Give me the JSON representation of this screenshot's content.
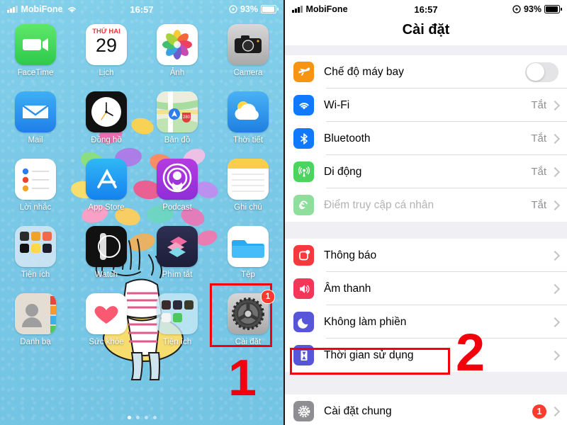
{
  "left_screen": {
    "name": "iphone-home-screen",
    "status_bar": {
      "carrier": "MobiFone",
      "time": "16:57",
      "battery_percent": "93%",
      "signal_icon": "signal-bars-icon",
      "wifi_icon": "wifi-icon",
      "lock_icon": "rotation-lock-icon",
      "battery_icon": "battery-icon"
    },
    "apps": [
      [
        {
          "label": "FaceTime",
          "icon": "facetime-icon"
        },
        {
          "label": "Lịch",
          "icon": "calendar-icon",
          "day_label": "THỨ HAI",
          "day_number": "29"
        },
        {
          "label": "Ảnh",
          "icon": "photos-icon"
        },
        {
          "label": "Camera",
          "icon": "camera-icon"
        }
      ],
      [
        {
          "label": "Mail",
          "icon": "mail-icon"
        },
        {
          "label": "Đồng hồ",
          "icon": "clock-icon"
        },
        {
          "label": "Bản đồ",
          "icon": "maps-icon"
        },
        {
          "label": "Thời tiết",
          "icon": "weather-icon"
        }
      ],
      [
        {
          "label": "Lời nhắc",
          "icon": "reminders-icon"
        },
        {
          "label": "App Store",
          "icon": "app-store-icon"
        },
        {
          "label": "Podcast",
          "icon": "podcasts-icon"
        },
        {
          "label": "Ghi chú",
          "icon": "notes-icon"
        }
      ],
      [
        {
          "label": "Tiện ích",
          "icon": "folder-utilities-icon"
        },
        {
          "label": "Watch",
          "icon": "watch-icon"
        },
        {
          "label": "Phím tắt",
          "icon": "shortcuts-icon"
        },
        {
          "label": "Tệp",
          "icon": "files-icon"
        }
      ],
      [
        {
          "label": "Danh bạ",
          "icon": "contacts-icon"
        },
        {
          "label": "Sức khỏe",
          "icon": "health-icon"
        },
        {
          "label": "Tiện ích",
          "icon": "folder-extras-icon"
        },
        {
          "label": "Cài đặt",
          "icon": "settings-gear-icon",
          "badge": "1",
          "highlighted": true
        }
      ]
    ],
    "page_dots": 4,
    "page_dot_active": 1,
    "step_marker": "1",
    "highlight_color": "#f3000d"
  },
  "right_screen": {
    "name": "ios-settings-screen",
    "status_bar": {
      "carrier": "MobiFone",
      "time": "16:57",
      "battery_percent": "93%",
      "signal_icon": "signal-bars-icon",
      "lock_icon": "rotation-lock-icon",
      "battery_icon": "battery-icon"
    },
    "nav_title": "Cài đặt",
    "groups": [
      {
        "name": "connectivity-group",
        "rows": [
          {
            "label": "Chế độ máy bay",
            "icon": "airplane-icon",
            "icon_color": "#f89414",
            "control": "toggle",
            "toggle_on": false
          },
          {
            "label": "Wi-Fi",
            "icon": "wifi-icon",
            "icon_color": "#1079fd",
            "value": "Tắt",
            "control": "chevron"
          },
          {
            "label": "Bluetooth",
            "icon": "bluetooth-icon",
            "icon_color": "#1079fd",
            "value": "Tắt",
            "control": "chevron"
          },
          {
            "label": "Di động",
            "icon": "cellular-icon",
            "icon_color": "#4cd45f",
            "value": "Tắt",
            "control": "chevron"
          },
          {
            "label": "Điểm truy cập cá nhân",
            "icon": "hotspot-icon",
            "icon_color": "#8fdf9c",
            "value": "Tắt",
            "control": "chevron",
            "dimmed": true
          }
        ]
      },
      {
        "name": "alerts-group",
        "rows": [
          {
            "label": "Thông báo",
            "icon": "notifications-icon",
            "icon_color": "#f5393d",
            "control": "chevron"
          },
          {
            "label": "Âm thanh",
            "icon": "sounds-icon",
            "icon_color": "#f43658",
            "control": "chevron"
          },
          {
            "label": "Không làm phiền",
            "icon": "do-not-disturb-icon",
            "icon_color": "#5755d8",
            "control": "chevron"
          },
          {
            "label": "Thời gian sử dụng",
            "icon": "screen-time-icon",
            "icon_color": "#5755d8",
            "control": "chevron",
            "highlighted": true
          }
        ]
      },
      {
        "name": "general-group",
        "rows": [
          {
            "label": "Cài đặt chung",
            "icon": "general-gear-icon",
            "icon_color": "#8e8e93",
            "badge": "1",
            "control": "chevron"
          }
        ]
      }
    ],
    "step_marker": "2",
    "highlight_color": "#f3000d"
  }
}
